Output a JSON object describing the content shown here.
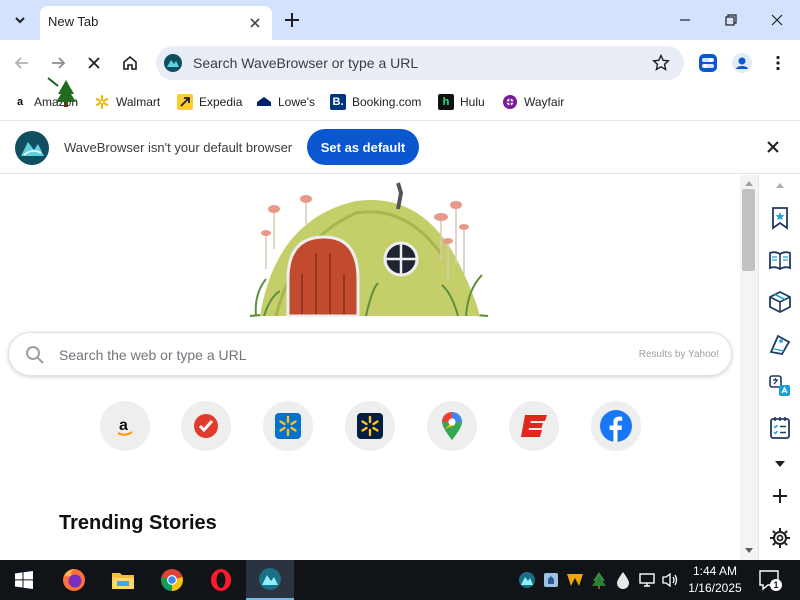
{
  "colors": {
    "tabstrip_bg": "#d3e3fd",
    "accent_blue": "#0b57d0",
    "omnibox_bg": "#e9eef6",
    "taskbar_bg": "#101418"
  },
  "tab": {
    "title": "New Tab",
    "close_icon": "close-icon"
  },
  "window": {
    "new_tab_icon": "plus-icon",
    "minimize_icon": "minimize-icon",
    "maximize_icon": "restore-icon",
    "close_icon": "close-icon"
  },
  "toolbar": {
    "back_icon": "arrow-left-icon",
    "forward_icon": "arrow-right-icon",
    "stop_icon": "close-icon",
    "home_icon": "home-icon",
    "omnibox_text": "Search WaveBrowser or type a URL",
    "bookmark_star_icon": "star-icon",
    "extension_icon": "toggle-icon",
    "profile_icon": "person-icon",
    "menu_icon": "more-vertical-icon"
  },
  "bookmarks": [
    {
      "label": "Amazon",
      "icon": "amazon-icon"
    },
    {
      "label": "Walmart",
      "icon": "walmart-icon"
    },
    {
      "label": "Expedia",
      "icon": "expedia-icon"
    },
    {
      "label": "Lowe's",
      "icon": "lowes-icon"
    },
    {
      "label": "Booking.com",
      "icon": "booking-icon"
    },
    {
      "label": "Hulu",
      "icon": "hulu-icon"
    },
    {
      "label": "Wayfair",
      "icon": "wayfair-icon"
    }
  ],
  "infobar": {
    "message": "WaveBrowser isn't your default browser",
    "button": "Set as default"
  },
  "newtab": {
    "search_placeholder": "Search the web or type a URL",
    "search_provider": "Results by Yahoo!",
    "tiles": [
      "amazon",
      "todoist",
      "walmart",
      "walmart-dark",
      "google-maps",
      "espn",
      "facebook"
    ],
    "trending_heading": "Trending Stories"
  },
  "sidepanel": {
    "icons": [
      "scroll-up-icon",
      "bookmark-star-icon",
      "book-icon",
      "package-icon",
      "tag-icon",
      "translate-icon",
      "checklist-icon",
      "chevron-down-icon",
      "plus-icon",
      "settings-gear-icon"
    ]
  },
  "taskbar": {
    "apps": [
      "windows-start-icon",
      "firefox-icon",
      "file-explorer-icon",
      "chrome-icon",
      "opera-icon",
      "wavebrowser-icon"
    ],
    "time": "1:44 AM",
    "date": "1/16/2025",
    "notification_count": "1"
  }
}
